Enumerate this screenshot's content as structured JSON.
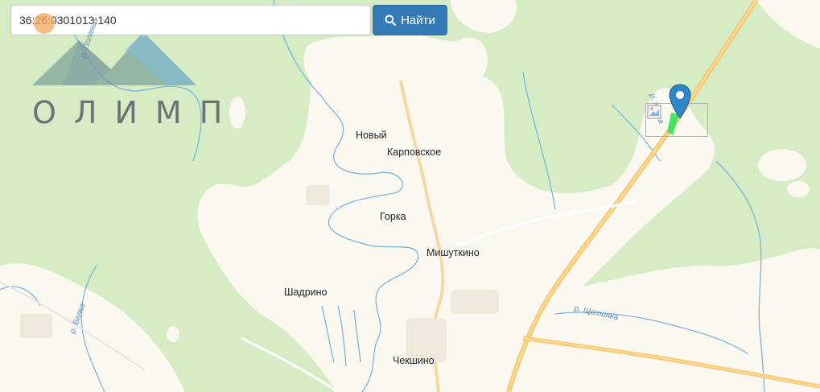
{
  "search": {
    "value": "36:26:0301013:140",
    "button_label": "Найти",
    "button_icon": "search-icon"
  },
  "logo": {
    "text": "ОЛИМП"
  },
  "map": {
    "places": [
      "Новый",
      "Карповское",
      "Горка",
      "Мишуткино",
      "Шадрино",
      "Чекшино"
    ],
    "rivers": [
      "р. Поланга",
      "р. Курна",
      "р. Белка",
      "р. Щетинка"
    ]
  },
  "colors": {
    "forest": "#d6ecc4",
    "open_land": "#fbf8ef",
    "road": "#f6c56b",
    "water": "#7fb3de",
    "button": "#337ab7",
    "marker": "#2f86c9",
    "parcel": "#34e35a"
  }
}
